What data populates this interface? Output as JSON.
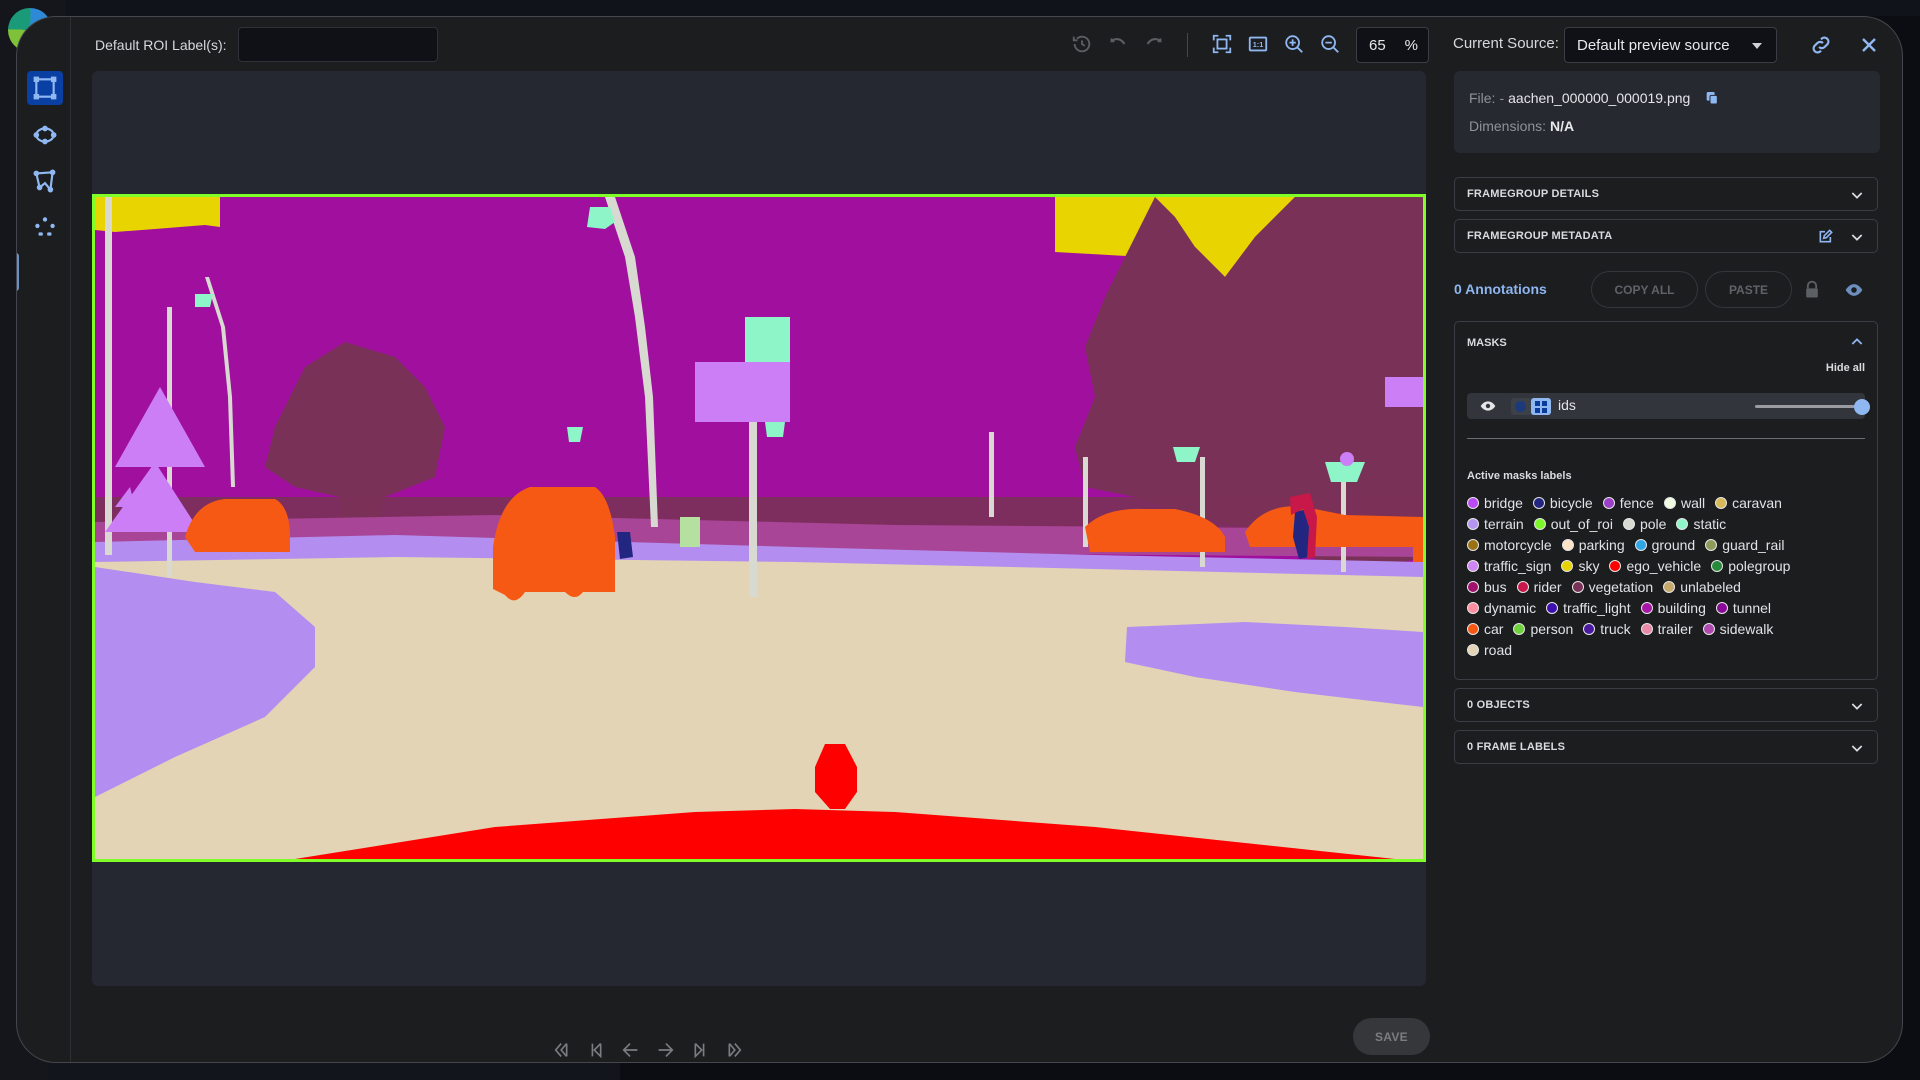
{
  "header": {
    "roi_label": "Default ROI Label(s):",
    "roi_input_value": "",
    "zoom_value": "65",
    "zoom_unit": "%",
    "source_label": "Current Source:",
    "source_value": "Default preview source"
  },
  "toolbar": {
    "icons": [
      "history-icon",
      "undo-icon",
      "redo-icon",
      "fit-screen-icon",
      "actual-size-icon",
      "zoom-in-icon",
      "zoom-out-icon"
    ]
  },
  "tools": [
    "bounding-box-tool",
    "ellipse-tool",
    "polygon-tool",
    "keypoints-tool"
  ],
  "file_info": {
    "file_label": "File:",
    "file_prefix": "-",
    "file_name": "aachen_000000_000019.png",
    "dimensions_label": "Dimensions:",
    "dimensions_value": "N/A"
  },
  "sections": {
    "framegroup_details": "FRAMEGROUP DETAILS",
    "framegroup_metadata": "FRAMEGROUP METADATA",
    "objects": "0 OBJECTS",
    "frame_labels": "0 FRAME LABELS"
  },
  "annotations": {
    "count_label": "0 Annotations",
    "copy_all": "COPY ALL",
    "paste": "PASTE"
  },
  "masks": {
    "title": "MASKS",
    "hide_all": "Hide all",
    "mask_name": "ids",
    "opacity": 1.0,
    "active_labels_title": "Active masks labels",
    "label_rows": [
      [
        {
          "name": "bridge",
          "color": "#b94bf2"
        },
        {
          "name": "bicycle",
          "color": "#232680"
        },
        {
          "name": "fence",
          "color": "#9b3ec8"
        },
        {
          "name": "wall",
          "color": "#f0fde0"
        },
        {
          "name": "caravan",
          "color": "#d7b95a"
        }
      ],
      [
        {
          "name": "terrain",
          "color": "#b596f0"
        },
        {
          "name": "out_of_roi",
          "color": "#7df72a"
        },
        {
          "name": "pole",
          "color": "#d8dad2"
        },
        {
          "name": "static",
          "color": "#8ef5c8"
        }
      ],
      [
        {
          "name": "motorcycle",
          "color": "#9a7113"
        },
        {
          "name": "parking",
          "color": "#fee3c6"
        },
        {
          "name": "ground",
          "color": "#2fa6e6"
        },
        {
          "name": "guard_rail",
          "color": "#8d9c5a"
        }
      ],
      [
        {
          "name": "traffic_sign",
          "color": "#d085f5"
        },
        {
          "name": "sky",
          "color": "#e8d400"
        },
        {
          "name": "ego_vehicle",
          "color": "#ff0000"
        },
        {
          "name": "polegroup",
          "color": "#268a3a"
        }
      ],
      [
        {
          "name": "bus",
          "color": "#a0106e"
        },
        {
          "name": "rider",
          "color": "#c8184a"
        },
        {
          "name": "vegetation",
          "color": "#7a3158"
        },
        {
          "name": "unlabeled",
          "color": "#c6aa6c"
        }
      ],
      [
        {
          "name": "dynamic",
          "color": "#ff8fa0"
        },
        {
          "name": "traffic_light",
          "color": "#3d0fb0"
        },
        {
          "name": "building",
          "color": "#a616a8"
        },
        {
          "name": "tunnel",
          "color": "#8a0a98"
        }
      ],
      [
        {
          "name": "car",
          "color": "#f65914"
        },
        {
          "name": "person",
          "color": "#6ed23c"
        },
        {
          "name": "truck",
          "color": "#4b1aa0"
        },
        {
          "name": "trailer",
          "color": "#e88aa8"
        },
        {
          "name": "sidewalk",
          "color": "#b04ab0"
        }
      ],
      [
        {
          "name": "road",
          "color": "#e2d4b4"
        }
      ]
    ]
  },
  "footer": {
    "save": "SAVE",
    "nav": [
      "first-frame",
      "previous-keyframe",
      "previous-frame",
      "next-frame",
      "next-keyframe",
      "last-frame"
    ]
  }
}
